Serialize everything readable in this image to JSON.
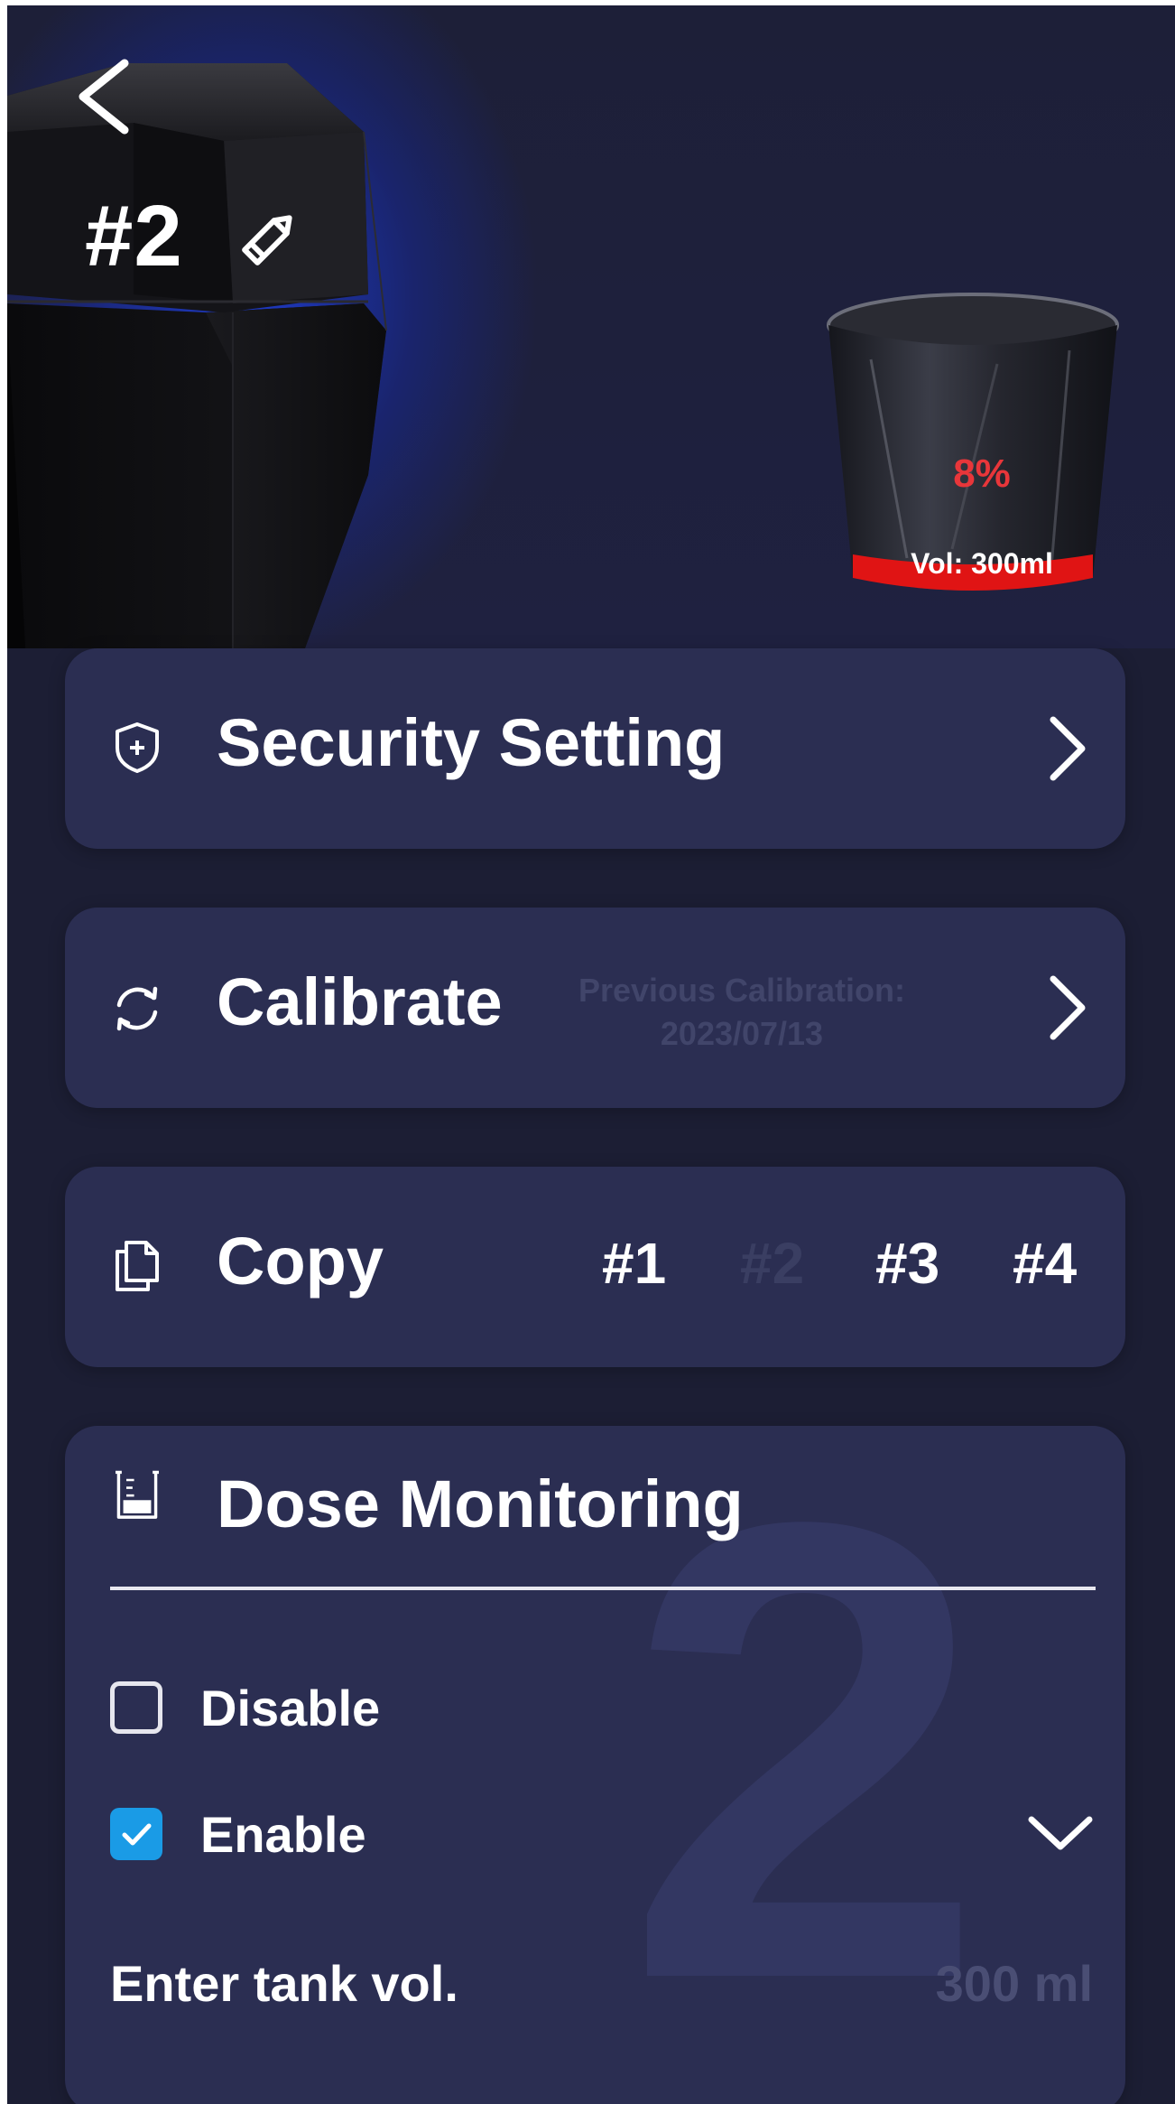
{
  "header": {
    "device_name": "#2",
    "tank_percent": "8%",
    "tank_volume": "Vol: 300ml"
  },
  "menu": {
    "security": {
      "title": "Security Setting"
    },
    "calibrate": {
      "title": "Calibrate",
      "note_line1": "Previous Calibration:",
      "note_line2": "2023/07/13"
    },
    "copy": {
      "title": "Copy",
      "options": [
        "#1",
        "#2",
        "#3",
        "#4"
      ],
      "disabled_option": "#2"
    }
  },
  "dose_monitoring": {
    "title": "Dose Monitoring",
    "watermark": "2",
    "options": [
      {
        "label": "Disable",
        "checked": false
      },
      {
        "label": "Enable",
        "checked": true
      }
    ],
    "tank_label": "Enter tank vol.",
    "tank_placeholder": "300 ml"
  },
  "colors": {
    "background": "#1c1e34",
    "card": "#2b2e52",
    "accent_blue": "#1a9be6",
    "percent_red": "#e8363a",
    "glow": "#1e3cd2"
  },
  "icons": {
    "back": "back-arrow-icon",
    "edit": "pencil-icon",
    "security": "shield-icon",
    "calibrate": "refresh-icon",
    "copy": "copy-icon",
    "dose": "beaker-icon",
    "chevron": "chevron-right-icon",
    "dropdown": "chevron-down-icon"
  }
}
